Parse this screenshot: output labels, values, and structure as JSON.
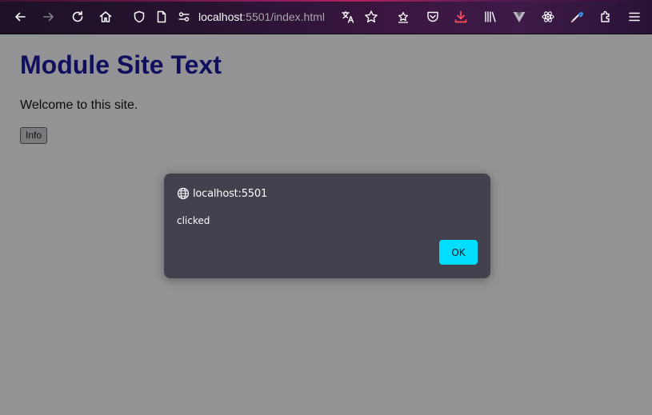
{
  "browser": {
    "url_host": "localhost",
    "url_path": ":5501/index.html",
    "icons": [
      "back-arrow-icon",
      "forward-arrow-icon",
      "reload-icon",
      "home-icon",
      "shield-icon",
      "page-icon",
      "permissions-icon",
      "translate-icon",
      "bookmark-star-icon",
      "pocket-star-icon",
      "save-to-pocket-icon",
      "download-icon",
      "library-icon",
      "vue-devtools-icon",
      "react-devtools-icon",
      "color-picker-icon",
      "extensions-icon",
      "menu-icon"
    ],
    "accent_download": "#ff4f5e"
  },
  "page": {
    "title": "Module Site Text",
    "text": "Welcome to this site.",
    "button_label": "Info"
  },
  "dialog": {
    "host": "localhost:5501",
    "message": "clicked",
    "ok_label": "OK",
    "ok_color": "#00ddff"
  }
}
